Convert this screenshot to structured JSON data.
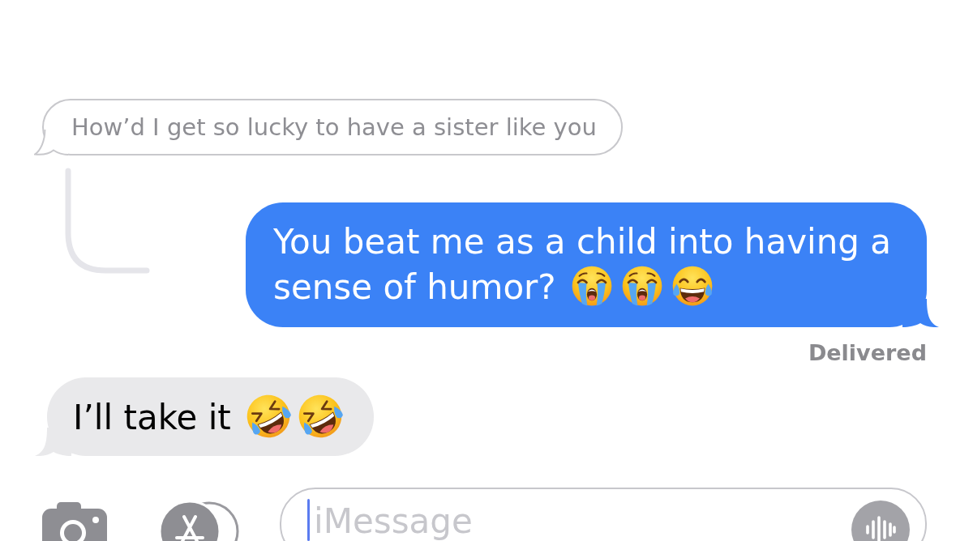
{
  "conversation": {
    "messages": [
      {
        "kind": "quoted",
        "text": "How’d I get so lucky to have a sister like you"
      },
      {
        "kind": "sent",
        "reply_thread": true,
        "text": "You beat me as a child into having a sense of humor?",
        "emojis": [
          {
            "kind": "loudly-crying"
          },
          {
            "kind": "loudly-crying"
          },
          {
            "kind": "tears-of-joy"
          }
        ],
        "status": "Delivered"
      },
      {
        "kind": "received",
        "text": "I’ll take it",
        "emojis": [
          {
            "kind": "rolling-laughing"
          },
          {
            "kind": "rolling-laughing"
          }
        ]
      }
    ]
  },
  "composer": {
    "placeholder": "iMessage",
    "focused": true
  }
}
